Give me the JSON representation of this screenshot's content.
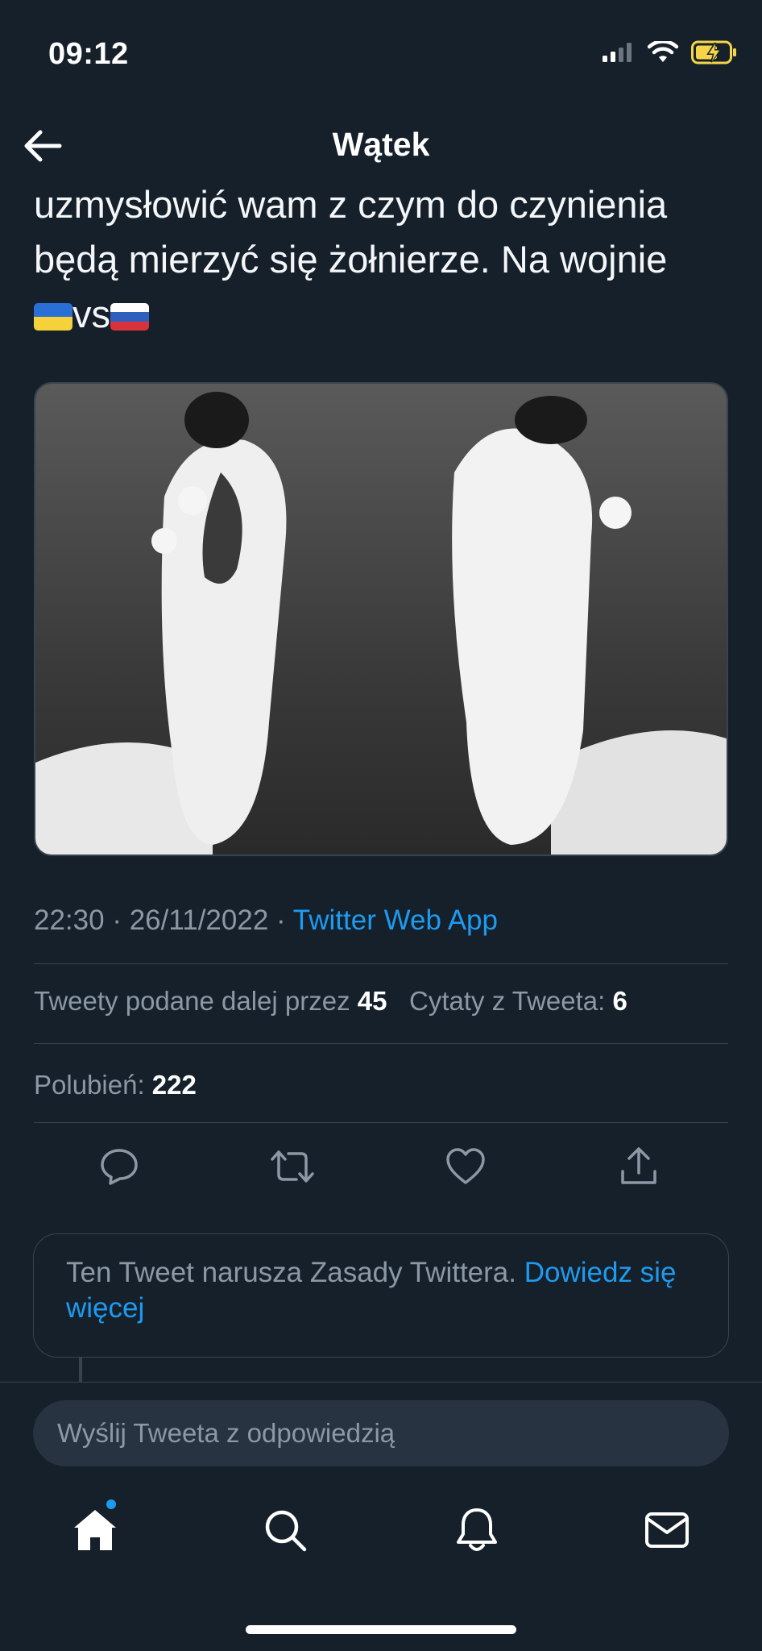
{
  "status_bar": {
    "time": "09:12"
  },
  "nav": {
    "title": "Wątek"
  },
  "tweet": {
    "text_line1": "uzmysłowić wam z czym do czynienia",
    "text_line2": "będą mierzyć się żołnierze. Na wojnie",
    "text_vs": "vs",
    "time": "22:30",
    "separator": "·",
    "date": "26/11/2022",
    "source": "Twitter Web App",
    "retweets_label": "Tweety podane dalej przez",
    "retweets_count": "45",
    "quotes_label": "Cytaty z Tweeta:",
    "quotes_count": "6",
    "likes_label": "Polubień:",
    "likes_count": "222"
  },
  "notice": {
    "text": "Ten Tweet narusza Zasady Twittera.",
    "link": "Dowiedz się więcej"
  },
  "reply": {
    "placeholder": "Wyślij Tweeta z odpowiedzią"
  },
  "icons": {
    "status": [
      "signal-icon",
      "wifi-icon",
      "battery-charging-icon"
    ],
    "actions": [
      "reply-icon",
      "retweet-icon",
      "like-icon",
      "share-icon"
    ],
    "tabs": [
      "home-icon",
      "search-icon",
      "notifications-icon",
      "messages-icon"
    ]
  },
  "colors": {
    "background": "#15202b",
    "accent": "#1d9bf0",
    "muted": "#8b98a5",
    "battery": "#f5d547"
  }
}
